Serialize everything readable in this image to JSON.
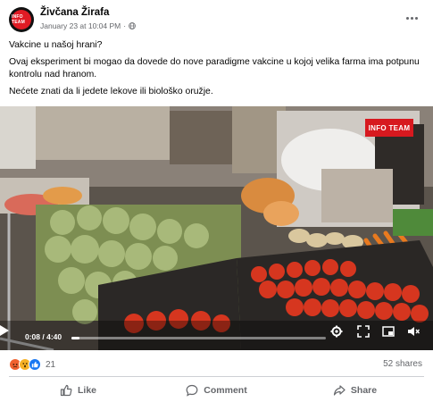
{
  "post": {
    "page_name": "Živčana Žirafa",
    "timestamp": "January 23 at 10:04 PM",
    "separator": "·",
    "avatar_text": "INFO TEAM",
    "paragraphs": [
      "Vakcine u našoj hrani?",
      "Ovaj eksperiment bi mogao da dovede do nove paradigme vakcine u kojoj velika farma ima potpunu kontrolu nad hranom.",
      "Nećete znati da li jedete lekove ili biološko oružje."
    ]
  },
  "video": {
    "brand_label": "INFO TEAM",
    "current_time": "0:08",
    "total_time": "4:40",
    "time_separator": " / ",
    "progress": 0.03
  },
  "engagement": {
    "reaction_icons": [
      "angry-reaction-icon",
      "wow-reaction-icon",
      "like-reaction-icon"
    ],
    "reaction_count": "21",
    "shares": "52 shares"
  },
  "actions": {
    "like": "Like",
    "comment": "Comment",
    "share": "Share"
  },
  "colors": {
    "secondary_text": "#65676b",
    "angry": "#f0612f",
    "wow": "#f7b125",
    "like": "#1877f2",
    "brand_red": "#d7191f"
  }
}
